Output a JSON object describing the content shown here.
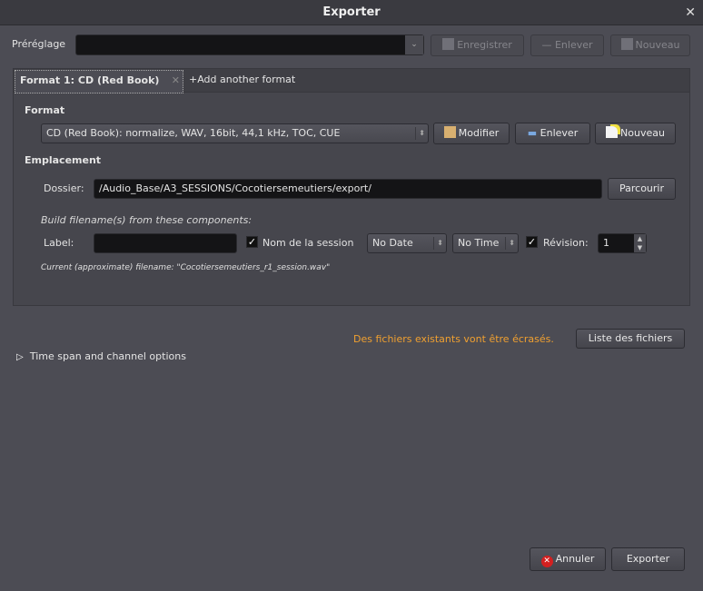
{
  "window": {
    "title": "Exporter"
  },
  "preset": {
    "label": "Préréglage",
    "value": "",
    "save": "Enregistrer",
    "remove": "Enlever",
    "new": "Nouveau"
  },
  "tabs": [
    {
      "label": "Format 1: CD (Red Book)"
    },
    {
      "label": "+Add another format"
    }
  ],
  "format": {
    "heading": "Format",
    "value": "CD (Red Book): normalize, WAV, 16bit, 44,1 kHz, TOC, CUE",
    "modify": "Modifier",
    "remove": "Enlever",
    "new": "Nouveau"
  },
  "location": {
    "heading": "Emplacement",
    "folder_label": "Dossier:",
    "folder": "/Audio_Base/A3_SESSIONS/Cocotiersemeutiers/export/",
    "browse": "Parcourir"
  },
  "filename": {
    "heading": "Build filename(s) from these components:",
    "label_label": "Label:",
    "label_value": "",
    "session_name": "Nom de la session",
    "session_checked": true,
    "date": "No Date",
    "time": "No Time",
    "revision_label": "Révision:",
    "revision_checked": true,
    "revision": "1",
    "current": "Current (approximate) filename: \"Cocotiersemeutiers_r1_session.wav\""
  },
  "warning": {
    "text": "Des fichiers existants vont être écrasés.",
    "color": "#f0a030",
    "list_files": "Liste des fichiers"
  },
  "time_span": {
    "label": "Time span and channel options"
  },
  "footer": {
    "cancel": "Annuler",
    "export": "Exporter"
  }
}
